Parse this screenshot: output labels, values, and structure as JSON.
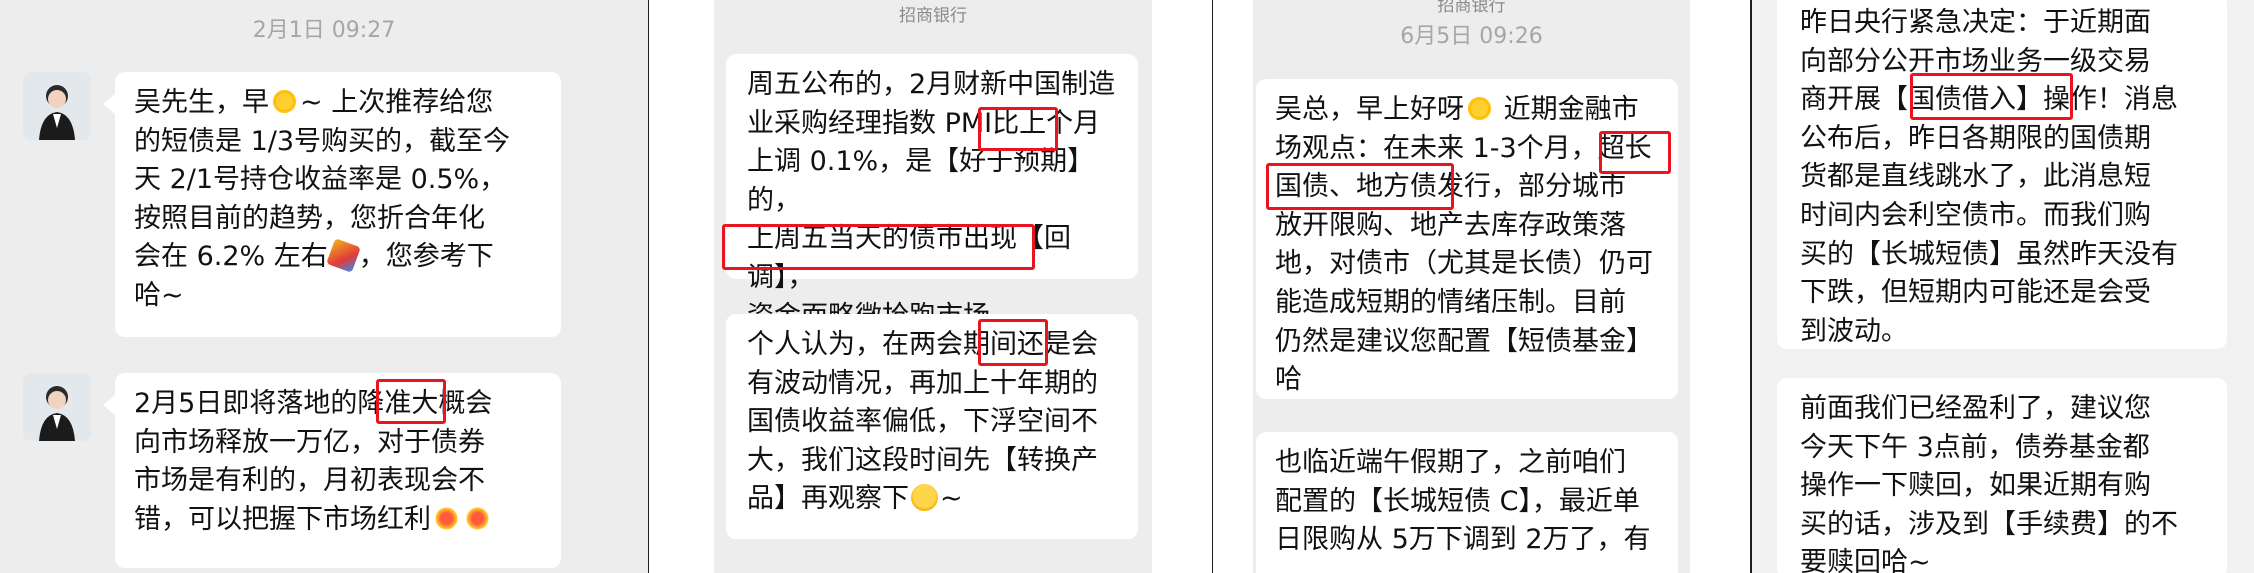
{
  "panel1": {
    "timestamp": "2月1日 09:27",
    "msg1": [
      "吴先生，早",
      "~ 上次推荐给您",
      "的短债是 1/3号购买的，截至今",
      "天 2/1号持仓收益率是 0.5%，",
      "按照目前的趋势，您折合年化",
      "会在 6.2% 左右",
      "，您参考下",
      "哈~"
    ],
    "msg2": [
      "2月5日即将落地的降准大概会",
      "向市场释放一万亿，对于债券",
      "市场是有利的，月初表现会不",
      "错，可以把握下市场红利"
    ]
  },
  "panel2": {
    "bank_name": "招商银行",
    "msg1": [
      "周五公布的，2月财新中国制造",
      "业采购经理指数 PMI比上个月",
      "上调 0.1%，是【好于预期】的，",
      "上周五当天的债市出现【回调】，",
      "资金面略微抢跑市场~"
    ],
    "msg2": [
      "个人认为，在两会期间还是会",
      "有波动情况，再加上十年期的",
      "国债收益率偏低，下浮空间不",
      "大，我们这段时间先【转换产",
      "品】再观察下",
      "~"
    ]
  },
  "panel3": {
    "bank_name": "招商银行",
    "timestamp": "6月5日 09:26",
    "msg1": [
      "吴总，早上好呀",
      " 近期金融市",
      "场观点：在未来 1-3个月，超长",
      "国债、地方债发行，部分城市",
      "放开限购、地产去库存政策落",
      "地，对债市（尤其是长债）仍可",
      "能造成短期的情绪压制。目前",
      "仍然是建议您配置【短债基金】",
      "哈"
    ],
    "msg2": [
      "也临近端午假期了，之前咱们",
      "配置的【长城短债 C】，最近单",
      "日限购从 5万下调到 2万了，有"
    ]
  },
  "panel4": {
    "msg1": [
      "昨日央行紧急决定：于近期面",
      "向部分公开市场业务一级交易",
      "商开展【国债借入】操作！消息",
      "公布后，昨日各期限的国债期",
      "货都是直线跳水了，此消息短",
      "时间内会利空债市。而我们购",
      "买的【长城短债】虽然昨天没有",
      "下跌，但短期内可能还是会受",
      "到波动。"
    ],
    "msg2": [
      "前面我们已经盈利了，建议您",
      "今天下午 3点前，债券基金都",
      "操作一下赎回，如果近期有购",
      "买的话，涉及到【手续费】的不",
      "要赎回哈~"
    ]
  }
}
